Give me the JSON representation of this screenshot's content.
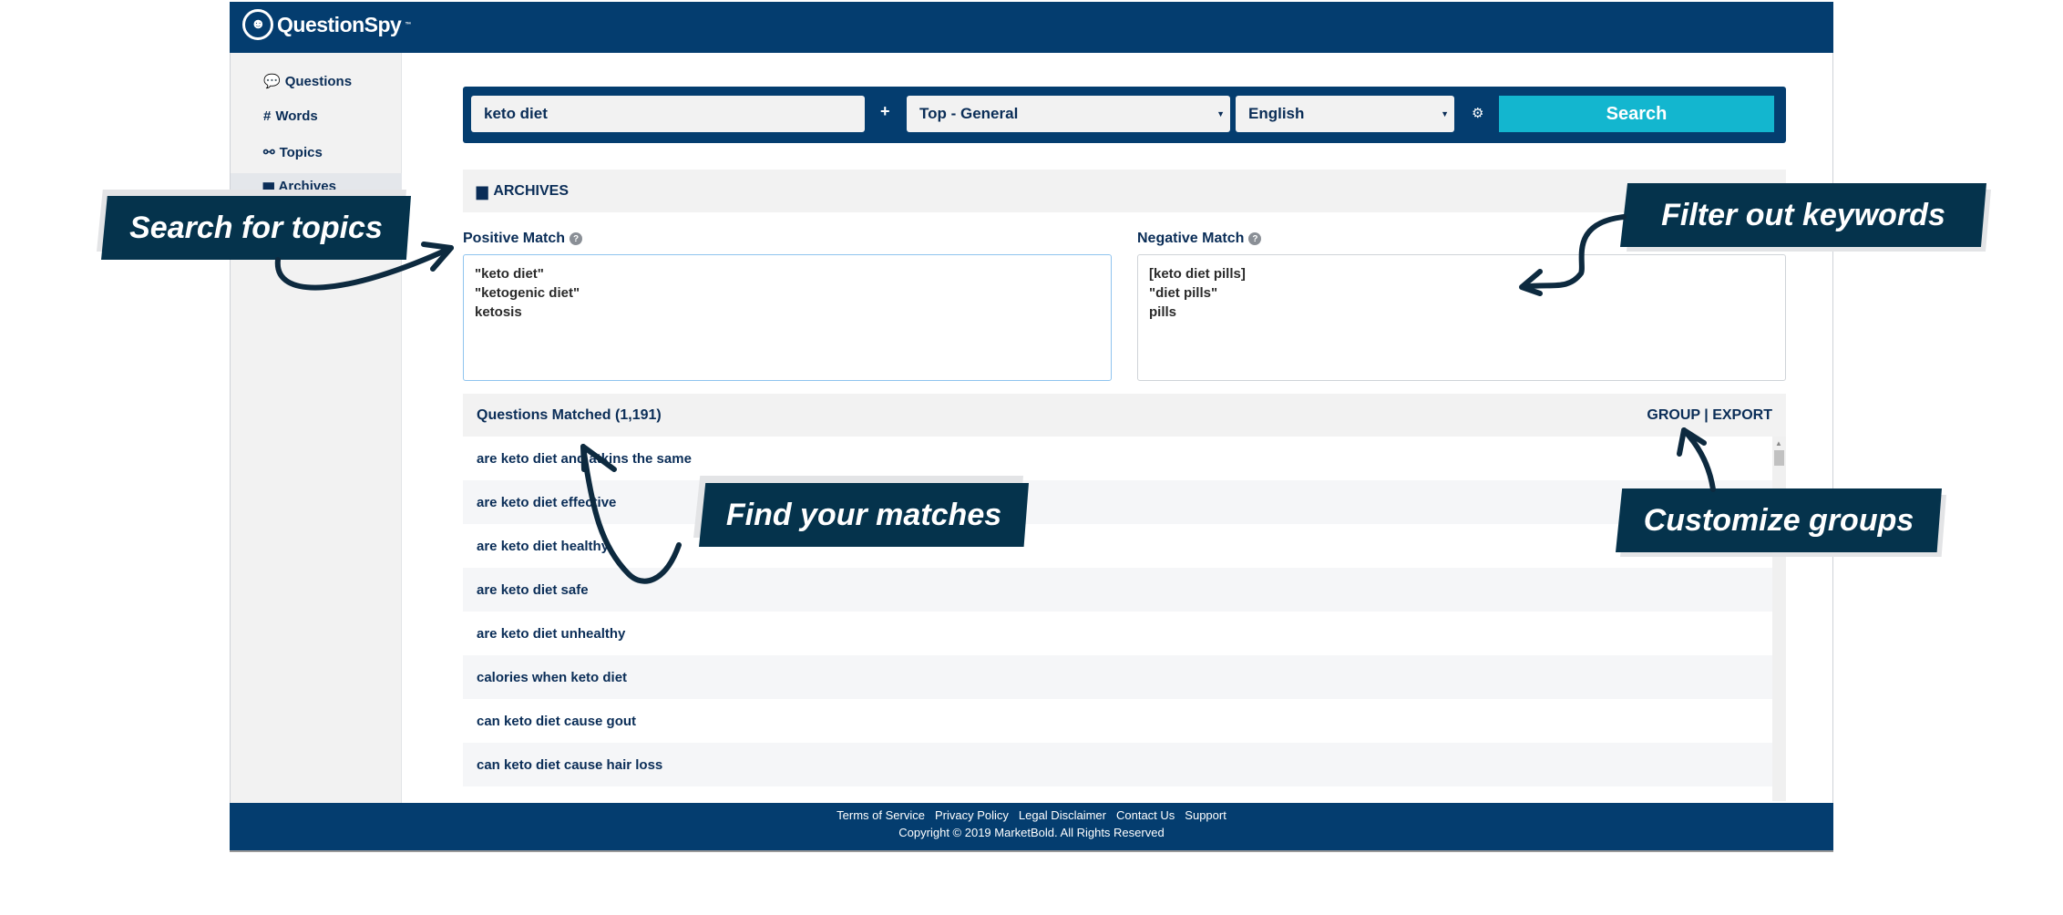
{
  "app": {
    "name": "QuestionSpy",
    "trademark": "™"
  },
  "sidebar": {
    "items": [
      {
        "label": "Questions",
        "icon": "comments-icon"
      },
      {
        "label": "Words",
        "icon": "hashtag-icon"
      },
      {
        "label": "Topics",
        "icon": "link-icon"
      },
      {
        "label": "Archives",
        "icon": "folder-icon",
        "active": true
      }
    ]
  },
  "search": {
    "query": "keto diet",
    "plus": "+",
    "source": "Top - General",
    "language": "English",
    "button": "Search"
  },
  "archives": {
    "title": "ARCHIVES"
  },
  "positive": {
    "label": "Positive Match",
    "value": "\"keto diet\"\n\"ketogenic diet\"\nketosis"
  },
  "negative": {
    "label": "Negative Match",
    "value": "[keto diet pills]\n\"diet pills\"\npills"
  },
  "results": {
    "title": "Questions Matched (1,191)",
    "group": "GROUP",
    "sep": "|",
    "export": "EXPORT",
    "rows": [
      "are keto diet and atkins the same",
      "are keto diet effective",
      "are keto diet healthy",
      "are keto diet safe",
      "are keto diet unhealthy",
      "calories when keto diet",
      "can keto diet cause gout",
      "can keto diet cause hair loss",
      ""
    ]
  },
  "footer": {
    "links": [
      "Terms of Service",
      "Privacy Policy",
      "Legal Disclaimer",
      "Contact Us",
      "Support"
    ],
    "copyright": "Copyright © 2019 MarketBold. All Rights Reserved"
  },
  "callouts": {
    "search": "Search for topics",
    "filter": "Filter out keywords",
    "matches": "Find your matches",
    "groups": "Customize groups"
  },
  "colors": {
    "navy": "#043d6f",
    "accent": "#13b6cf",
    "callout": "#05334c"
  }
}
